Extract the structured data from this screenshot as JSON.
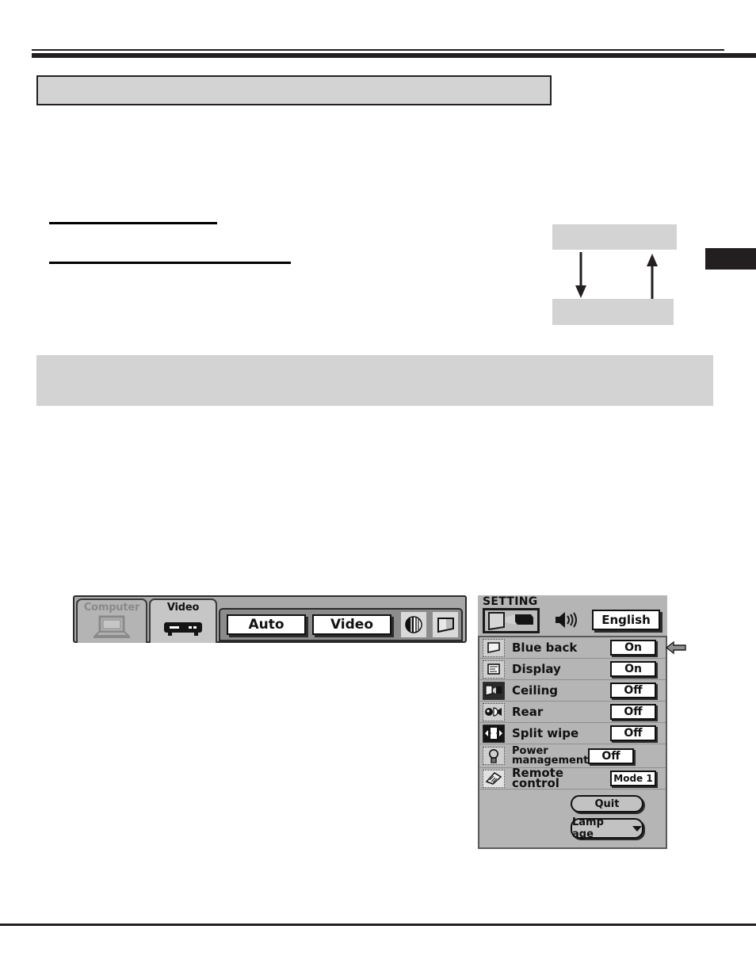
{
  "page": {
    "rules": {
      "present": true
    },
    "placeholder_blocks": 4,
    "tab_marker_color": "#231f20"
  },
  "osd": {
    "menubar": {
      "tabs": [
        {
          "label": "Computer",
          "icon": "laptop-icon",
          "state": "inactive"
        },
        {
          "label": "Video",
          "icon": "vcr-icon",
          "state": "active"
        }
      ],
      "source_buttons": [
        {
          "label": "Auto",
          "name": "auto-source-button"
        },
        {
          "label": "Video",
          "name": "video-source-button"
        }
      ],
      "source_icons": [
        {
          "name": "image-adjust-icon"
        },
        {
          "name": "screen-adjust-icon"
        }
      ]
    },
    "setting": {
      "title": "SETTING",
      "head_icon": "projector-setting-icon",
      "sound_icon": "speaker-icon",
      "language": "English",
      "rows": [
        {
          "icon": "blue-back-icon",
          "label": "Blue back",
          "value": "On",
          "pointer": true
        },
        {
          "icon": "display-icon",
          "label": "Display",
          "value": "On",
          "pointer": false
        },
        {
          "icon": "ceiling-icon",
          "label": "Ceiling",
          "value": "Off",
          "pointer": false
        },
        {
          "icon": "rear-projection-icon",
          "label": "Rear",
          "value": "Off",
          "pointer": false
        },
        {
          "icon": "split-wipe-icon",
          "label": "Split wipe",
          "value": "Off",
          "pointer": false
        },
        {
          "icon": "lamp-bulb-icon",
          "label": "Power management",
          "value": "Off",
          "pointer": false
        },
        {
          "icon": "remote-control-icon",
          "label": "Remote control",
          "value": "Mode 1",
          "pointer": false
        }
      ],
      "buttons": [
        {
          "label": "Quit",
          "name": "quit-button",
          "caret": false
        },
        {
          "label": "Lamp age",
          "name": "lamp-age-button",
          "caret": true
        }
      ]
    }
  },
  "colors": {
    "ink": "#231f20",
    "placeholder_grey": "#d3d3d3",
    "osd_grey": "#b5b5b5",
    "osd_dark_grey": "#8c8c8c"
  }
}
